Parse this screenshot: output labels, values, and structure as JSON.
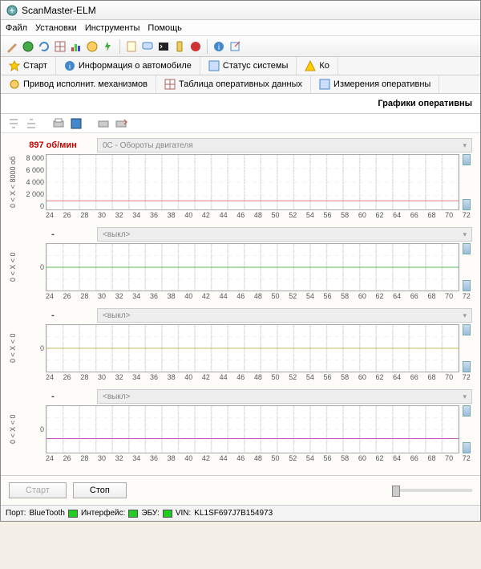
{
  "window": {
    "title": "ScanMaster-ELM"
  },
  "menu": {
    "file": "Файл",
    "setup": "Установки",
    "tools": "Инструменты",
    "help": "Помощь"
  },
  "tabs1": {
    "start": "Старт",
    "info": "Информация о автомобиле",
    "status": "Статус системы",
    "codes": "Ко"
  },
  "tabs2": {
    "actuators": "Привод исполнит. механизмов",
    "table": "Таблица оперативных данных",
    "measure": "Измерения оперативны"
  },
  "page_title": "Графики оперативны",
  "buttons": {
    "start": "Старт",
    "stop": "Стоп"
  },
  "status": {
    "port_label": "Порт:",
    "port_val": "BlueTooth",
    "iface_label": "Интерфейс:",
    "ecu_label": "ЭБУ:",
    "vin_label": "VIN:",
    "vin_val": "KL1SF697J7B154973"
  },
  "charts": [
    {
      "value_label": "897 об/мин",
      "value_color": "#c00",
      "selector": "0C - Обороты двигателя",
      "ylabel": "0 < X < 8000 об",
      "yticks": [
        "8 000",
        "6 000",
        "4 000",
        "2 000",
        "0"
      ],
      "line_color": "#d55",
      "line_pos": 0.84,
      "height": 70
    },
    {
      "value_label": "-",
      "value_color": "#333",
      "selector": "<выкл>",
      "ylabel": "0 < X < 0",
      "yticks": [
        "",
        "0",
        ""
      ],
      "line_color": "#2a2",
      "line_pos": 0.5,
      "height": 60
    },
    {
      "value_label": "-",
      "value_color": "#333",
      "selector": "<выкл>",
      "ylabel": "0 < X < 0",
      "yticks": [
        "",
        "0",
        ""
      ],
      "line_color": "#aa2",
      "line_pos": 0.5,
      "height": 60
    },
    {
      "value_label": "-",
      "value_color": "#333",
      "selector": "<выкл>",
      "ylabel": "0 < X < 0",
      "yticks": [
        "",
        "0",
        ""
      ],
      "line_color": "#a2a",
      "line_pos": 0.7,
      "height": 60
    }
  ],
  "xticks": [
    "24",
    "26",
    "28",
    "30",
    "32",
    "34",
    "36",
    "38",
    "40",
    "42",
    "44",
    "46",
    "48",
    "50",
    "52",
    "54",
    "56",
    "58",
    "60",
    "62",
    "64",
    "66",
    "68",
    "70",
    "72"
  ],
  "chart_data": {
    "type": "line",
    "charts": [
      {
        "series_name": "Обороты двигателя (об/мин)",
        "ylim": [
          0,
          8000
        ],
        "value": 897,
        "x_range": [
          24,
          72
        ],
        "approx_y": 900
      },
      {
        "series_name": "<выкл>",
        "ylim": [
          0,
          0
        ],
        "value": null
      },
      {
        "series_name": "<выкл>",
        "ylim": [
          0,
          0
        ],
        "value": null
      },
      {
        "series_name": "<выкл>",
        "ylim": [
          0,
          0
        ],
        "value": null
      }
    ],
    "x_ticks": [
      24,
      26,
      28,
      30,
      32,
      34,
      36,
      38,
      40,
      42,
      44,
      46,
      48,
      50,
      52,
      54,
      56,
      58,
      60,
      62,
      64,
      66,
      68,
      70,
      72
    ]
  }
}
